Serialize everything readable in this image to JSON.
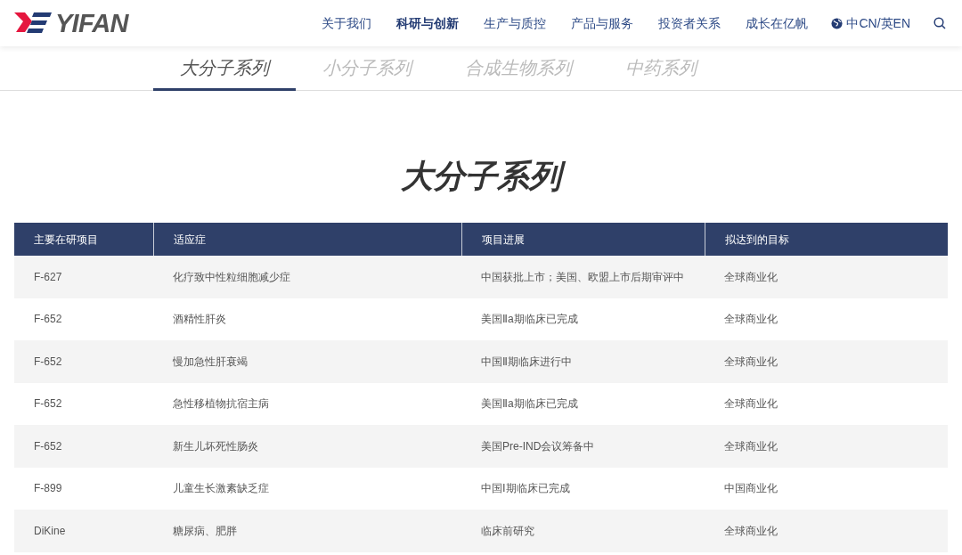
{
  "header": {
    "logo": "YIFAN",
    "nav": [
      {
        "label": "关于我们",
        "selected": false
      },
      {
        "label": "科研与创新",
        "selected": true
      },
      {
        "label": "生产与质控",
        "selected": false
      },
      {
        "label": "产品与服务",
        "selected": false
      },
      {
        "label": "投资者关系",
        "selected": false
      },
      {
        "label": "成长在亿帆",
        "selected": false
      }
    ],
    "language": "中CN/英EN"
  },
  "tabs": [
    {
      "label": "大分子系列",
      "selected": true
    },
    {
      "label": "小分子系列",
      "selected": false
    },
    {
      "label": "合成生物系列",
      "selected": false
    },
    {
      "label": "中药系列",
      "selected": false
    }
  ],
  "heading": "大分子系列",
  "table": {
    "columns": [
      "主要在研项目",
      "适应症",
      "项目进展",
      "拟达到的目标"
    ],
    "rows": [
      [
        "F-627",
        "化疗致中性粒细胞减少症",
        "中国获批上市；美国、欧盟上市后期审评中",
        "全球商业化"
      ],
      [
        "F-652",
        "酒精性肝炎",
        "美国Ⅱa期临床已完成",
        "全球商业化"
      ],
      [
        "F-652",
        "慢加急性肝衰竭",
        "中国Ⅱ期临床进行中",
        "全球商业化"
      ],
      [
        "F-652",
        "急性移植物抗宿主病",
        "美国Ⅱa期临床已完成",
        "全球商业化"
      ],
      [
        "F-652",
        "新生儿坏死性肠炎",
        "美国Pre-IND会议筹备中",
        "全球商业化"
      ],
      [
        "F-899",
        "儿童生长激素缺乏症",
        "中国Ⅰ期临床已完成",
        "中国商业化"
      ],
      [
        "DiKine",
        "糖尿病、肥胖",
        "临床前研究",
        "全球商业化"
      ]
    ]
  }
}
